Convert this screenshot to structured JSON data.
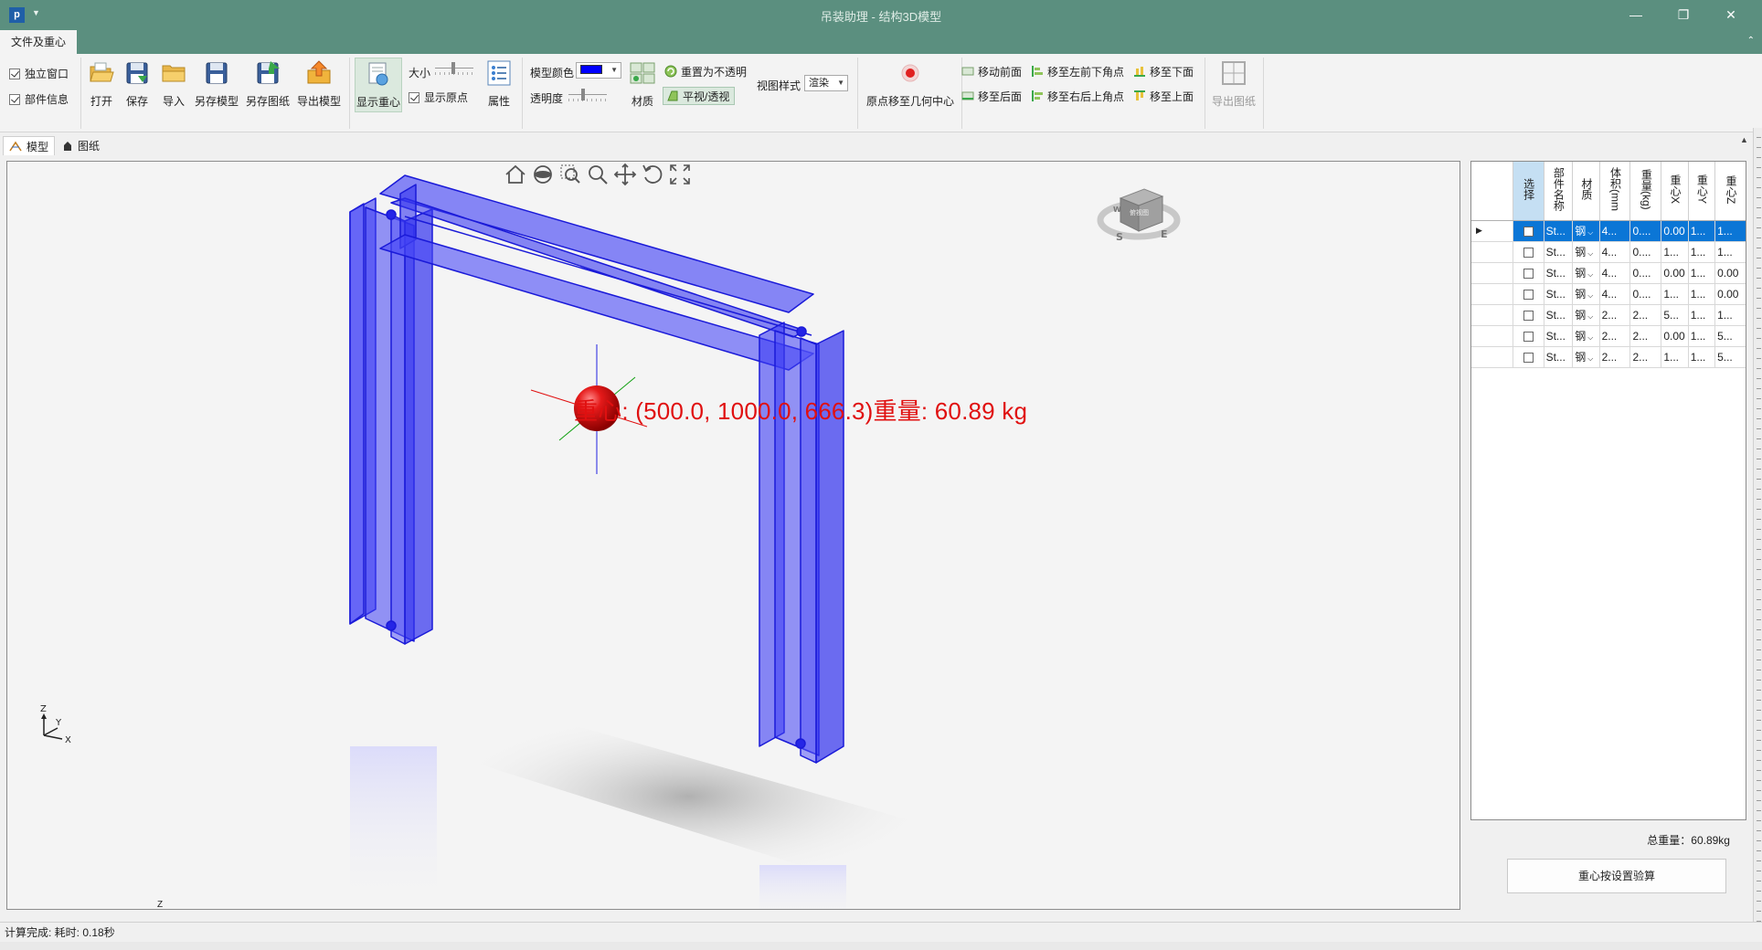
{
  "window": {
    "title": "吊装助理 - 结构3D模型",
    "minimize": "—",
    "restore": "❐",
    "close": "✕"
  },
  "app_icon": "p",
  "ribbon_tab": "文件及重心",
  "ribbon": {
    "checkbox_independent_window": "独立窗口",
    "checkbox_part_info": "部件信息",
    "btn_open": "打开",
    "btn_save": "保存",
    "btn_import": "导入",
    "btn_save_model_as": "另存模型",
    "btn_save_drawing_as": "另存图纸",
    "btn_export_model": "导出模型",
    "btn_show_cog": "显示重心",
    "size_label": "大小",
    "checkbox_show_origin": "显示原点",
    "btn_properties": "属性",
    "model_color_label": "模型颜色",
    "model_color_value": "#0000ff",
    "transparency_label": "透明度",
    "btn_material": "材质",
    "btn_reset_opaque": "重置为不透明",
    "btn_ortho_persp": "平视/透视",
    "view_style_label": "视图样式",
    "view_style_value": "渲染",
    "btn_origin_to_center": "原点移至几何中心",
    "btn_move_front": "移动前面",
    "btn_move_back": "移至后面",
    "btn_move_left_front_bottom": "移至左前下角点",
    "btn_move_right_back_top": "移至右后上角点",
    "btn_move_bottom": "移至下面",
    "btn_move_top": "移至上面",
    "btn_export_drawing": "导出图纸"
  },
  "doc_tabs": [
    {
      "label": "模型",
      "icon": "model-icon",
      "active": true
    },
    {
      "label": "图纸",
      "icon": "drawing-icon",
      "active": false
    }
  ],
  "viewport": {
    "cog_label": "重心: (500.0, 1000.0, 666.3)重量: 60.89 kg",
    "model_color": "#2b2bff",
    "cog_color": "#e01010",
    "nav_icons": [
      "home-icon",
      "orbit-icon",
      "zoom-window-icon",
      "zoom-icon",
      "pan-icon",
      "rotate-icon",
      "fit-all-icon"
    ],
    "axis_labels": {
      "z": "Z",
      "y": "Y",
      "x": "X"
    },
    "view_cube_face": "俯视图",
    "compass": {
      "s": "S",
      "e": "E",
      "w": "W"
    }
  },
  "table": {
    "headers": [
      "选择",
      "部件名称",
      "材质",
      "体积(mm",
      "重量(kg)",
      "重心X",
      "重心Y",
      "重心Z"
    ],
    "rows": [
      {
        "checked": false,
        "name": "St...",
        "material": "钢",
        "volume": "4...",
        "weight": "0....",
        "cx": "0.00",
        "cy": "1...",
        "cz": "1..."
      },
      {
        "checked": false,
        "name": "St...",
        "material": "钢",
        "volume": "4...",
        "weight": "0....",
        "cx": "1...",
        "cy": "1...",
        "cz": "1..."
      },
      {
        "checked": false,
        "name": "St...",
        "material": "钢",
        "volume": "4...",
        "weight": "0....",
        "cx": "0.00",
        "cy": "1...",
        "cz": "0.00"
      },
      {
        "checked": false,
        "name": "St...",
        "material": "钢",
        "volume": "4...",
        "weight": "0....",
        "cx": "1...",
        "cy": "1...",
        "cz": "0.00"
      },
      {
        "checked": false,
        "name": "St...",
        "material": "钢",
        "volume": "2...",
        "weight": "2...",
        "cx": "5...",
        "cy": "1...",
        "cz": "1..."
      },
      {
        "checked": false,
        "name": "St...",
        "material": "钢",
        "volume": "2...",
        "weight": "2...",
        "cx": "0.00",
        "cy": "1...",
        "cz": "5..."
      },
      {
        "checked": false,
        "name": "St...",
        "material": "钢",
        "volume": "2...",
        "weight": "2...",
        "cx": "1...",
        "cy": "1...",
        "cz": "5..."
      }
    ],
    "total_weight": "总重量：60.89kg",
    "verify_button": "重心按设置验算"
  },
  "status": "计算完成: 耗时: 0.18秒"
}
